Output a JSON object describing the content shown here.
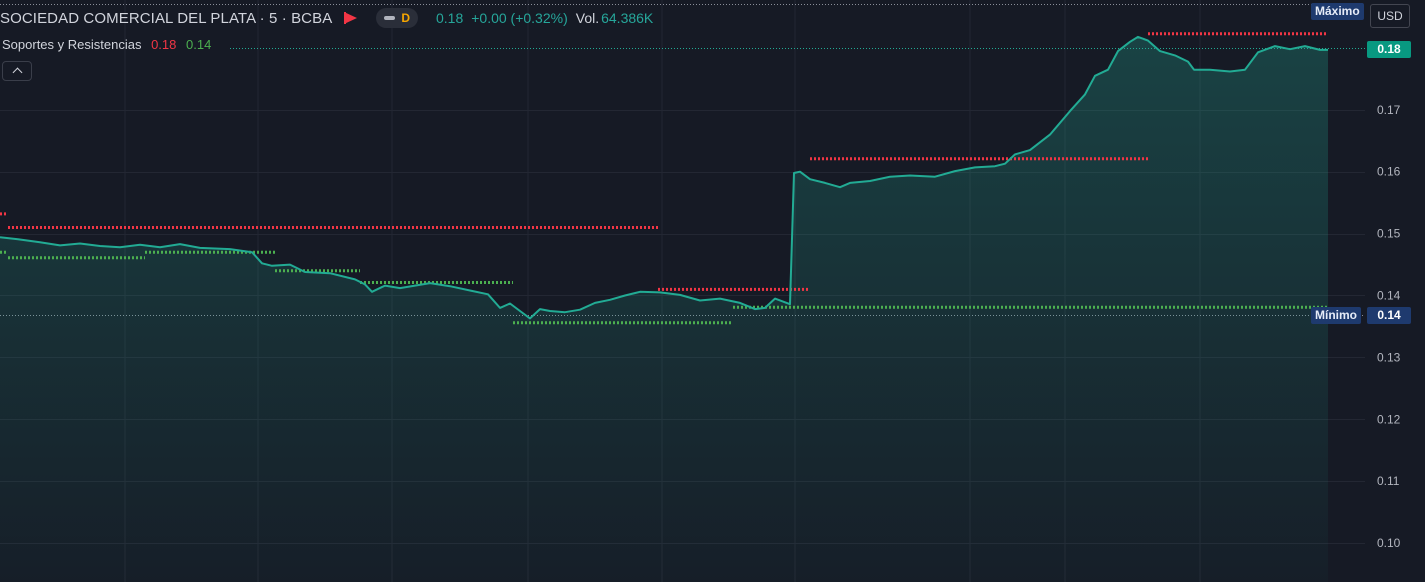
{
  "header": {
    "symbol_title": "SOCIEDAD COMERCIAL DEL PLATA · 5 · BCBA",
    "status_letter": "D",
    "last_price": "0.18",
    "change": "+0.00 (+0.32%)",
    "volume_label": "Vol.",
    "volume_value": "64.386K"
  },
  "indicator": {
    "name": "Soportes y Resistencias",
    "value1": "0.18",
    "value2": "0.14"
  },
  "currency": "USD",
  "labels": {
    "max": "Máximo",
    "min": "Mínimo",
    "last_price_badge": "0.18",
    "min_price_badge": "0.14"
  },
  "colors": {
    "background": "#161a25",
    "line": "#22ab94",
    "resistance": "#f23645",
    "support": "#4caf50",
    "grid": "#232733"
  },
  "chart_data": {
    "type": "area",
    "y_ticks": [
      "0.17",
      "0.16",
      "0.15",
      "0.14",
      "0.13",
      "0.12",
      "0.11",
      "0.10"
    ],
    "ylim": [
      0.0945,
      0.1823
    ],
    "x_range": [
      0,
      1328
    ],
    "last_value": 0.1797,
    "price_series": [
      [
        0,
        0.1494
      ],
      [
        18,
        0.1491
      ],
      [
        40,
        0.1486
      ],
      [
        60,
        0.1481
      ],
      [
        80,
        0.1484
      ],
      [
        100,
        0.148
      ],
      [
        120,
        0.1478
      ],
      [
        140,
        0.1482
      ],
      [
        160,
        0.1478
      ],
      [
        180,
        0.1483
      ],
      [
        200,
        0.1477
      ],
      [
        230,
        0.1475
      ],
      [
        252,
        0.147
      ],
      [
        262,
        0.1452
      ],
      [
        272,
        0.1448
      ],
      [
        290,
        0.145
      ],
      [
        305,
        0.1438
      ],
      [
        330,
        0.1436
      ],
      [
        355,
        0.1426
      ],
      [
        365,
        0.1418
      ],
      [
        372,
        0.1406
      ],
      [
        385,
        0.1416
      ],
      [
        400,
        0.1412
      ],
      [
        415,
        0.1416
      ],
      [
        430,
        0.142
      ],
      [
        450,
        0.1415
      ],
      [
        470,
        0.1408
      ],
      [
        488,
        0.1402
      ],
      [
        500,
        0.138
      ],
      [
        510,
        0.1387
      ],
      [
        520,
        0.1375
      ],
      [
        530,
        0.1363
      ],
      [
        540,
        0.1378
      ],
      [
        550,
        0.1375
      ],
      [
        565,
        0.1373
      ],
      [
        580,
        0.1377
      ],
      [
        595,
        0.1388
      ],
      [
        610,
        0.1393
      ],
      [
        625,
        0.14
      ],
      [
        640,
        0.1406
      ],
      [
        660,
        0.1405
      ],
      [
        680,
        0.1401
      ],
      [
        700,
        0.1392
      ],
      [
        720,
        0.1395
      ],
      [
        740,
        0.1388
      ],
      [
        755,
        0.1378
      ],
      [
        765,
        0.138
      ],
      [
        775,
        0.1395
      ],
      [
        790,
        0.1386
      ],
      [
        794,
        0.1598
      ],
      [
        800,
        0.16
      ],
      [
        810,
        0.1588
      ],
      [
        825,
        0.1582
      ],
      [
        840,
        0.1575
      ],
      [
        850,
        0.1582
      ],
      [
        870,
        0.1585
      ],
      [
        890,
        0.1592
      ],
      [
        910,
        0.1594
      ],
      [
        935,
        0.1592
      ],
      [
        955,
        0.1601
      ],
      [
        975,
        0.1607
      ],
      [
        995,
        0.1609
      ],
      [
        1005,
        0.1613
      ],
      [
        1015,
        0.1628
      ],
      [
        1030,
        0.1635
      ],
      [
        1050,
        0.166
      ],
      [
        1070,
        0.1698
      ],
      [
        1085,
        0.1725
      ],
      [
        1095,
        0.1755
      ],
      [
        1108,
        0.1765
      ],
      [
        1118,
        0.1795
      ],
      [
        1130,
        0.181
      ],
      [
        1138,
        0.1818
      ],
      [
        1148,
        0.1812
      ],
      [
        1160,
        0.1795
      ],
      [
        1175,
        0.1788
      ],
      [
        1188,
        0.1778
      ],
      [
        1194,
        0.1765
      ],
      [
        1210,
        0.1765
      ],
      [
        1230,
        0.1762
      ],
      [
        1245,
        0.1765
      ],
      [
        1258,
        0.1793
      ],
      [
        1275,
        0.1803
      ],
      [
        1290,
        0.1798
      ],
      [
        1305,
        0.1803
      ],
      [
        1320,
        0.1797
      ],
      [
        1328,
        0.1797
      ]
    ],
    "resistance_levels": [
      {
        "x1": 0,
        "x2": 8,
        "y": 0.1532
      },
      {
        "x1": 8,
        "x2": 658,
        "y": 0.151
      },
      {
        "x1": 658,
        "x2": 810,
        "y": 0.141
      },
      {
        "x1": 810,
        "x2": 1148,
        "y": 0.1621
      },
      {
        "x1": 1148,
        "x2": 1328,
        "y": 0.1823
      }
    ],
    "support_levels": [
      {
        "x1": 0,
        "x2": 8,
        "y": 0.147
      },
      {
        "x1": 8,
        "x2": 145,
        "y": 0.1461
      },
      {
        "x1": 145,
        "x2": 275,
        "y": 0.147
      },
      {
        "x1": 275,
        "x2": 360,
        "y": 0.144
      },
      {
        "x1": 360,
        "x2": 513,
        "y": 0.1421
      },
      {
        "x1": 513,
        "x2": 733,
        "y": 0.1356
      },
      {
        "x1": 733,
        "x2": 1328,
        "y": 0.1381
      }
    ],
    "max_value": 0.1823,
    "min_value": 0.1356
  }
}
